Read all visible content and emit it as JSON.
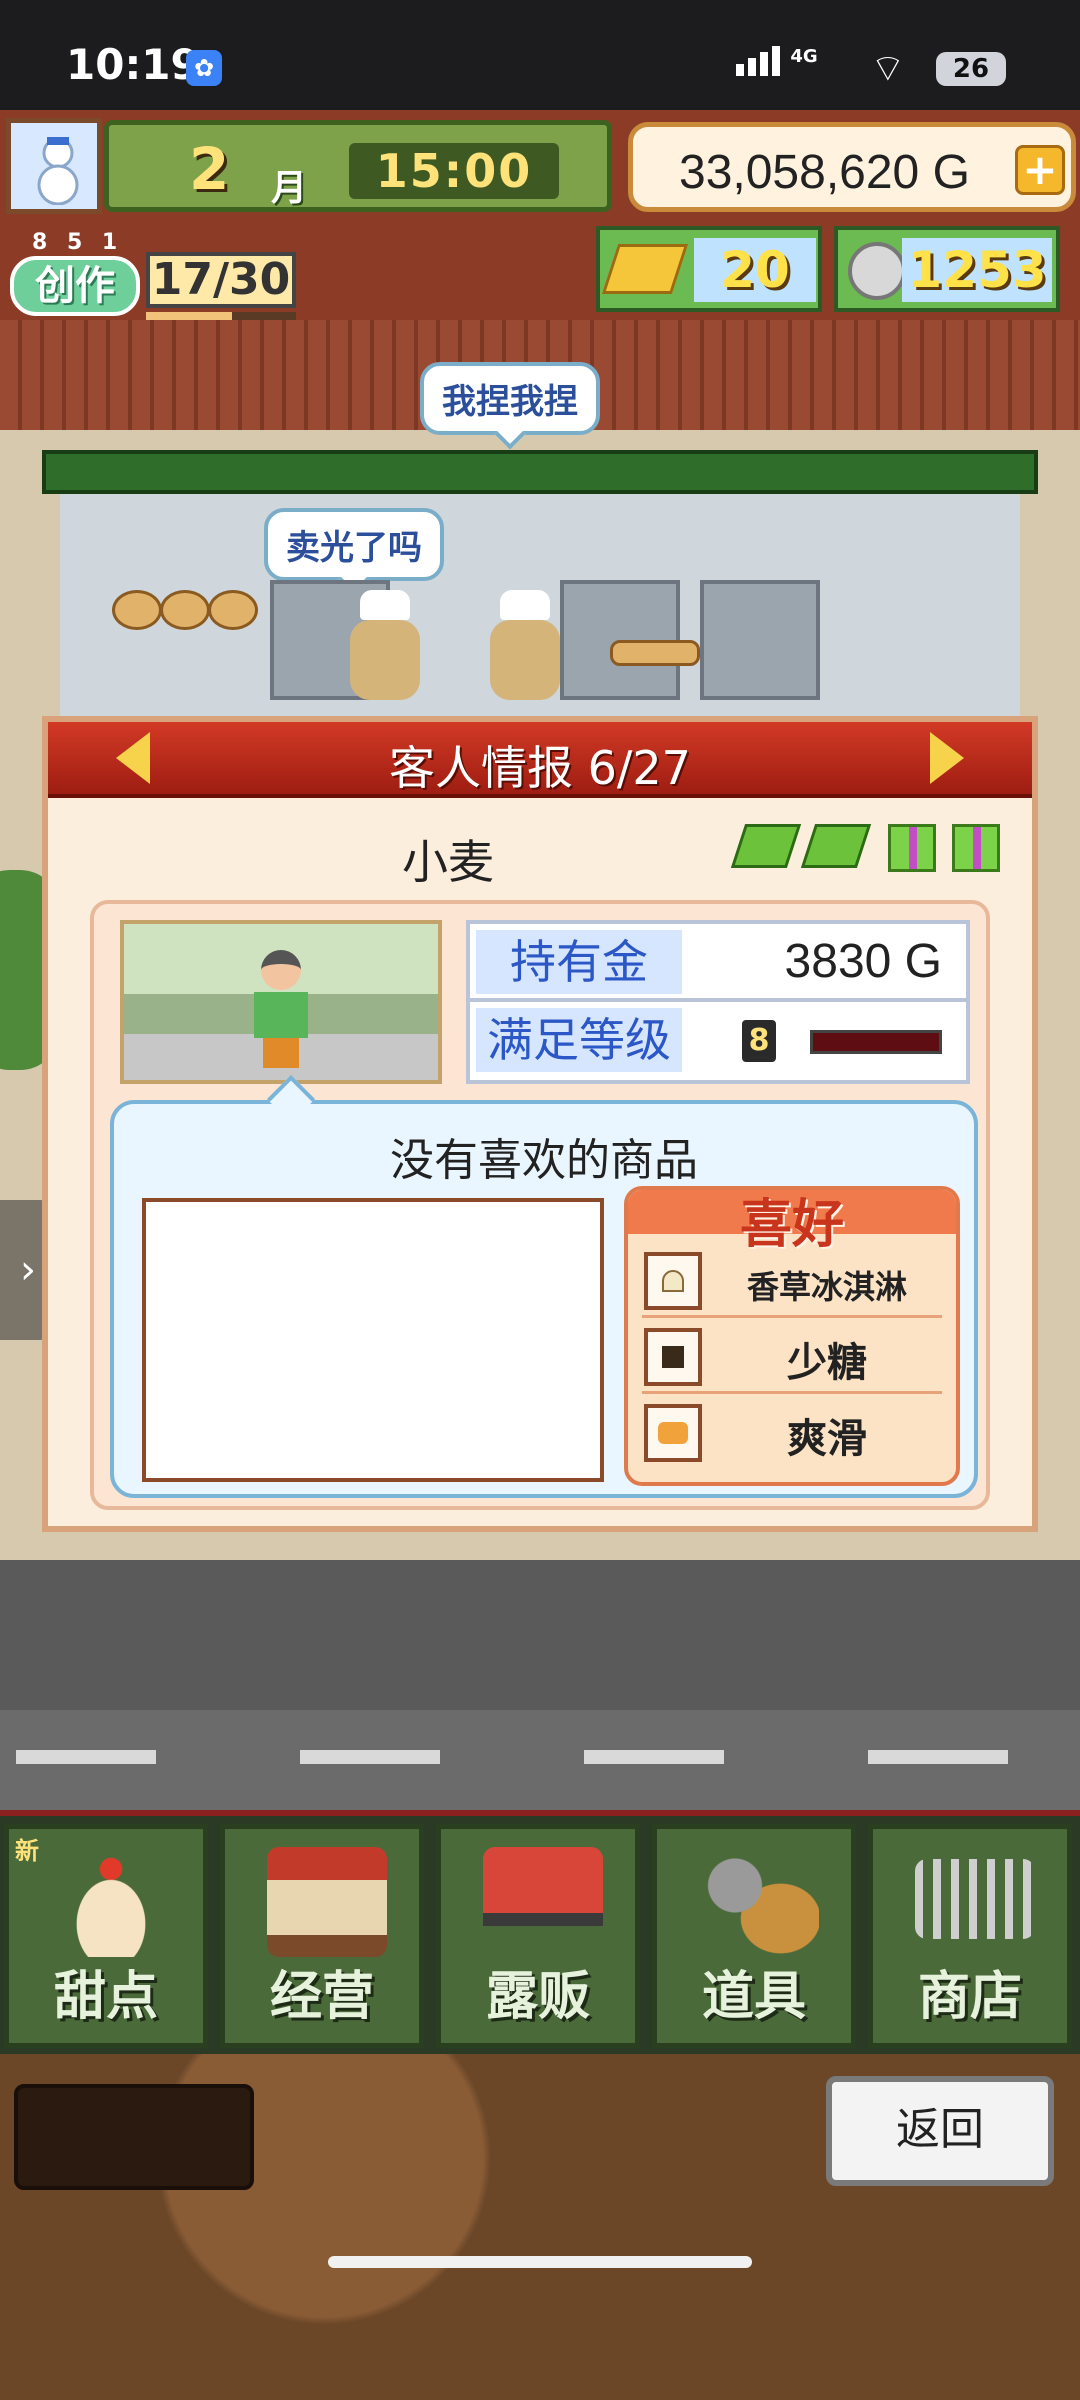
{
  "status_bar": {
    "time": "10:19",
    "network": "4G",
    "battery": "26"
  },
  "hud": {
    "month_number": "2",
    "month_unit": "月",
    "clock": "15:00",
    "money": "33,058,620 G",
    "create_label": "创作",
    "create_small": "8 5 1",
    "create_count": "17/30",
    "create_progress": 0.57,
    "gold_bars": "20",
    "silver_coins": "1253"
  },
  "scene": {
    "bubble_top": "我捏我捏",
    "bubble_mid": "卖光了吗"
  },
  "panel": {
    "title": "客人情报 6/27",
    "customer_name": "小麦",
    "money_label": "持有金",
    "money_value": "3830 G",
    "satisfaction_label": "满足等级",
    "satisfaction_level": "8",
    "favorite_message": "没有喜欢的商品",
    "prefs_title": "喜好",
    "prefs": [
      {
        "label": "香草冰淇淋",
        "icon": "ice-cream-icon"
      },
      {
        "label": "少糖",
        "icon": "sugar-icon"
      },
      {
        "label": "爽滑",
        "icon": "smooth-icon"
      }
    ]
  },
  "menu": {
    "new_badge": "新",
    "items": [
      {
        "label": "甜点",
        "icon": "cake-icon"
      },
      {
        "label": "经营",
        "icon": "shop-building-icon"
      },
      {
        "label": "露贩",
        "icon": "food-truck-icon"
      },
      {
        "label": "道具",
        "icon": "items-bag-icon"
      },
      {
        "label": "商店",
        "icon": "cart-icon"
      }
    ]
  },
  "footer": {
    "back_label": "返回"
  },
  "colors": {
    "header_red": "#d23a25",
    "stat_blue": "#2b58c6",
    "menu_green": "#4a6a3a"
  }
}
